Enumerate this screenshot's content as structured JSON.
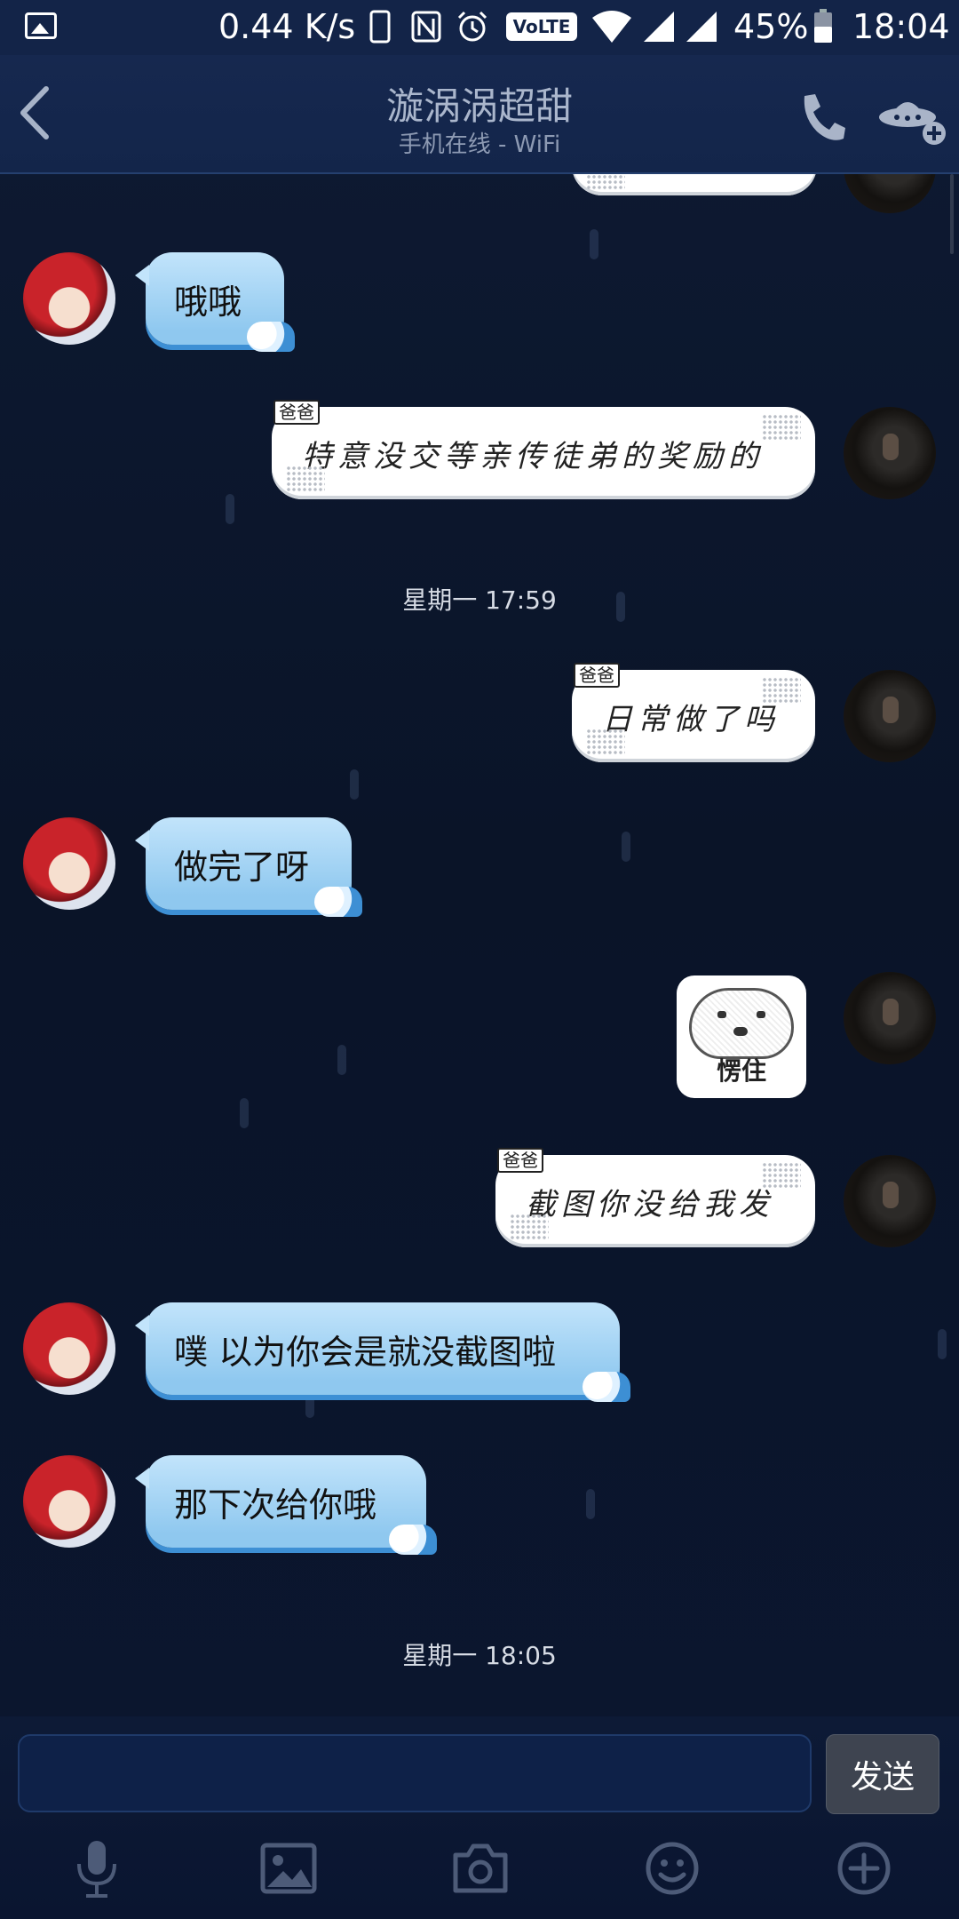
{
  "status_bar": {
    "speed": "0.44 K/s",
    "volte": "VoLTE",
    "battery_percent": "45%",
    "time": "18:04"
  },
  "header": {
    "title": "漩涡涡超甜",
    "subtitle": "手机在线 - WiFi"
  },
  "messages": {
    "m1": {
      "text": "哦哦"
    },
    "m2": {
      "tag": "爸爸",
      "text": "特意没交等亲传徒弟的奖励的"
    },
    "ts1": "星期一 17:59",
    "m3": {
      "tag": "爸爸",
      "text": "日常做了吗"
    },
    "m4": {
      "text": "做完了呀"
    },
    "m5": {
      "sticker_caption": "愣住"
    },
    "m6": {
      "tag": "爸爸",
      "text": "截图你没给我发"
    },
    "m7": {
      "text": "噗 以为你会是就没截图啦"
    },
    "m8": {
      "text": "那下次给你哦"
    },
    "ts2": "星期一 18:05"
  },
  "input": {
    "value": "",
    "send_label": "发送"
  },
  "colors": {
    "background": "#0b1428",
    "header": "#13254a",
    "bubble_left": "#a9d7f6",
    "bubble_right": "#ffffff",
    "send_button": "#3e4450"
  },
  "icons": {
    "toolbar": [
      "microphone-icon",
      "image-icon",
      "camera-icon",
      "emoji-icon",
      "plus-circle-icon"
    ]
  }
}
